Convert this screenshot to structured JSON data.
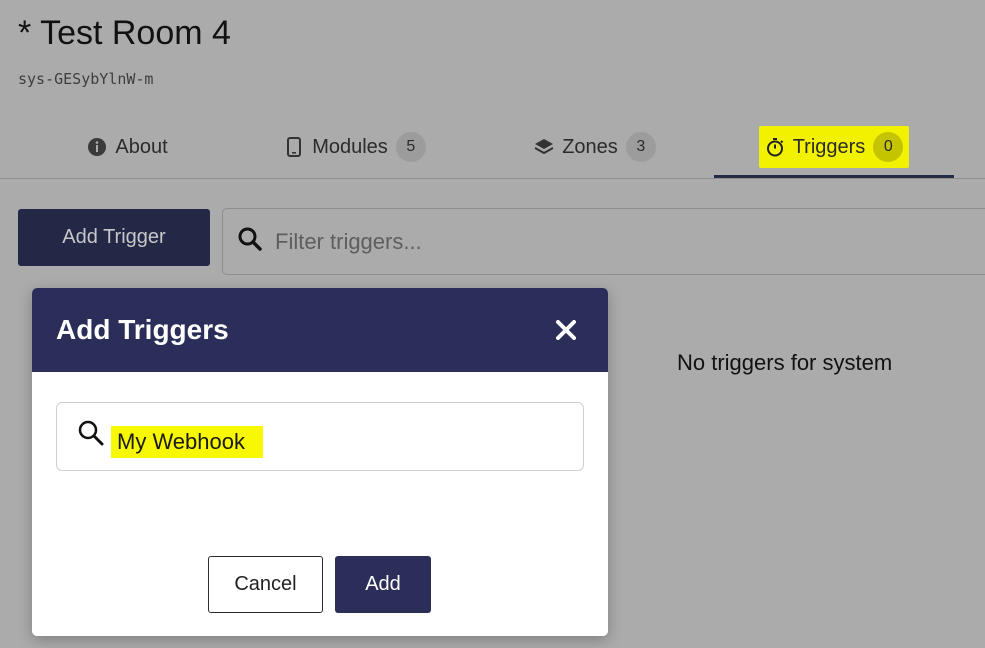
{
  "header": {
    "title": "* Test Room 4",
    "system_id": "sys-GESybYlnW-m"
  },
  "tabs": [
    {
      "label": "About",
      "icon": "info-circle-icon",
      "count": null
    },
    {
      "label": "Modules",
      "icon": "phone-icon",
      "count": "5"
    },
    {
      "label": "Zones",
      "icon": "layers-icon",
      "count": "3"
    },
    {
      "label": "Triggers",
      "icon": "stopwatch-icon",
      "count": "0",
      "active": true
    }
  ],
  "toolbar": {
    "add_trigger_label": "Add Trigger",
    "filter_placeholder": "Filter triggers..."
  },
  "empty_state": "No triggers for system",
  "modal": {
    "title": "Add Triggers",
    "search_value": "My Webhook",
    "cancel_label": "Cancel",
    "add_label": "Add"
  },
  "colors": {
    "overlay_bg": "#ababab",
    "brand_dark": "#2a2e58",
    "highlight": "#f2f200"
  }
}
